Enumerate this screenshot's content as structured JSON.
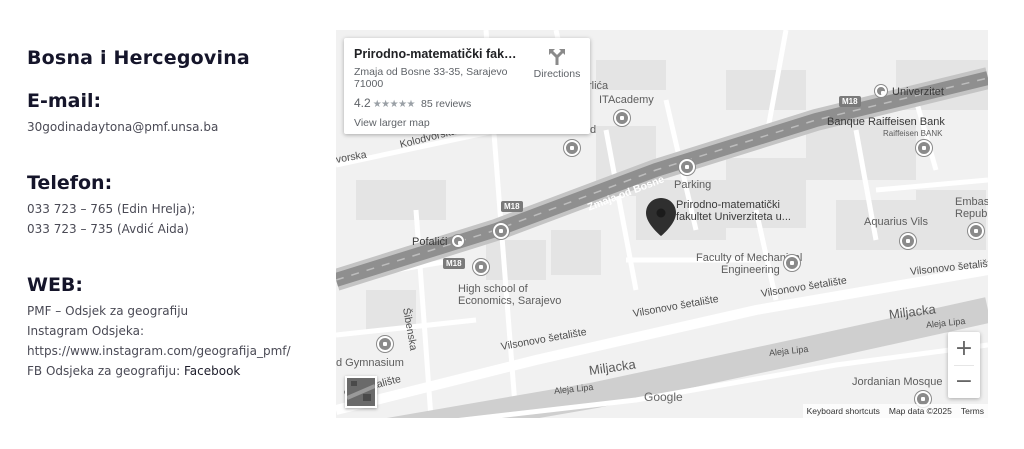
{
  "contact": {
    "region_title": "Bosna i Hercegovina",
    "email_heading": "E-mail:",
    "email_value": "30godinadaytona@pmf.unsa.ba",
    "phone_heading": "Telefon:",
    "phone_lines": [
      "033 723 – 765 (Edin Hrelja);",
      "033 723 – 735 (Avdić Aida)"
    ],
    "web_heading": "WEB:",
    "web_line1": "PMF – Odsjek za geografiju",
    "web_line2": "Instagram Odsjeka:",
    "web_line3": "https://www.instagram.com/geografija_pmf/",
    "web_line4_prefix": "FB Odsjeka za geografiju: ",
    "web_line4_link": "Facebook"
  },
  "map": {
    "info_card": {
      "title": "Prirodno-matematički fakultet...",
      "address": "Zmaja od Bosne 33-35, Sarajevo 71000",
      "rating": "4.2",
      "stars": "★★★★★",
      "reviews": "85 reviews",
      "view_larger": "View larger map",
      "directions_label": "Directions",
      "directions_icon": "directions-icon"
    },
    "labels": {
      "kolodvorska": "Kolodvorska",
      "vorska": "vorska",
      "lica": "rlića",
      "itacademy": "ITAcademy",
      "d_letter": "d",
      "univerzitet": "Univerzitet",
      "banque": "Banque Raiffeisen Bank",
      "raiffeisen_sub": "Raiffeisen BANK",
      "zmaja": "Zmaja od Bosne",
      "parking": "Parking",
      "pmf_pin_line1": "Prirodno-matematički",
      "pmf_pin_line2": "fakultet Univerziteta u...",
      "embas": "Embas",
      "republ": "Republ",
      "aquarius": "Aquarius Vils",
      "pofalici": "Pofalići",
      "faculty_mech_line1": "Faculty of Mechanical",
      "faculty_mech_line2": "Engineering",
      "high_school_line1": "High school of",
      "high_school_line2": "Economics, Sarajevo",
      "vilsonovo1": "Vilsonovo šetalište",
      "vilsonovo2": "Vilsonovo šetalište",
      "vilsonovo3": "Vilsonovo šetalište",
      "vilsonovo4": "Vilsonovo šetalište",
      "vilsonovo5": "Vilsonovo šetalište",
      "vilsonovo_short": "ovo šetalište",
      "miljacka1": "Miljacka",
      "miljacka2": "Miljacka",
      "aleja_lipa1": "Aleja Lipa",
      "aleja_lipa2": "Aleja Lipa",
      "aleja_lipa3": "Aleja Lipa",
      "sibenska": "Šibenska",
      "gymnasium": "d Gymnasium",
      "jordanian": "Jordanian Mosque",
      "m18_1": "M18",
      "m18_2": "M18",
      "m18_3": "M18"
    },
    "zoom_in": "+",
    "zoom_out": "−",
    "google": "Google",
    "attribution": {
      "shortcuts": "Keyboard shortcuts",
      "data": "Map data ©2025",
      "terms": "Terms"
    }
  }
}
